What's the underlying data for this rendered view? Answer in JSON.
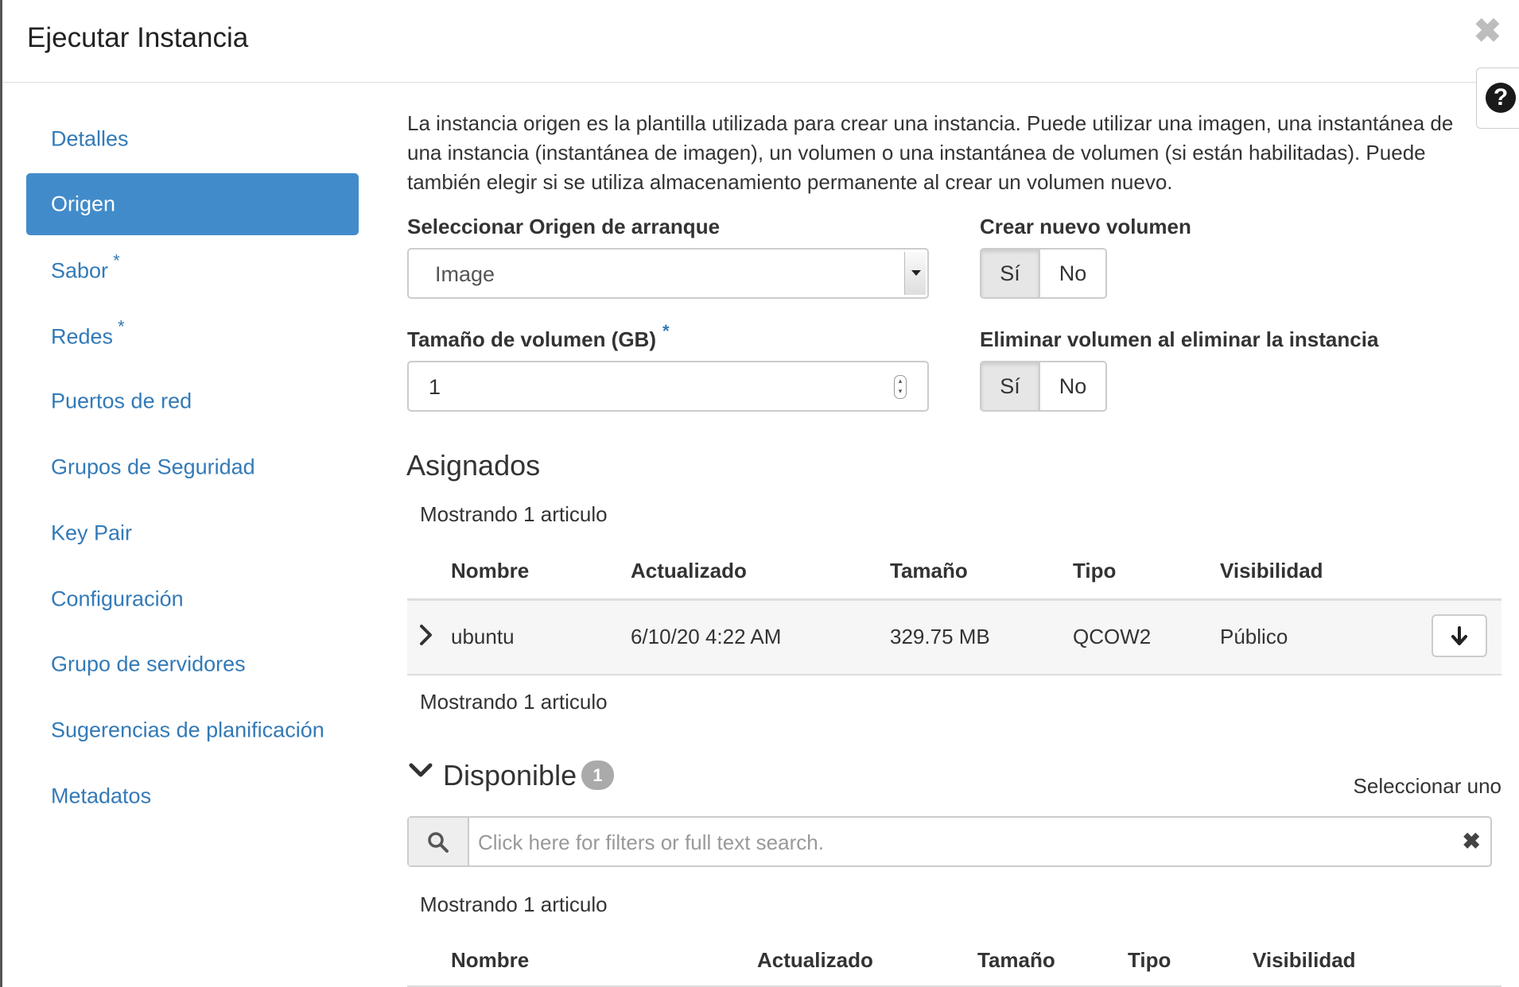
{
  "dialog": {
    "title": "Ejecutar Instancia",
    "close_glyph": "✖",
    "help_glyph": "?"
  },
  "sidebar": {
    "items": [
      {
        "label": "Detalles",
        "required": false,
        "active": false
      },
      {
        "label": "Origen",
        "required": false,
        "active": true
      },
      {
        "label": "Sabor",
        "required": true,
        "active": false
      },
      {
        "label": "Redes",
        "required": true,
        "active": false
      },
      {
        "label": "Puertos de red",
        "required": false,
        "active": false
      },
      {
        "label": "Grupos de Seguridad",
        "required": false,
        "active": false
      },
      {
        "label": "Key Pair",
        "required": false,
        "active": false
      },
      {
        "label": "Configuración",
        "required": false,
        "active": false
      },
      {
        "label": "Grupo de servidores",
        "required": false,
        "active": false
      },
      {
        "label": "Sugerencias de planificación",
        "required": false,
        "active": false
      },
      {
        "label": "Metadatos",
        "required": false,
        "active": false
      }
    ],
    "required_mark": "*"
  },
  "main": {
    "description": "La instancia origen es la plantilla utilizada para crear una instancia. Puede utilizar una imagen, una instantánea de una instancia (instantánea de imagen), un volumen o una instantánea de volumen (si están habilitadas). Puede también elegir si se utiliza almacenamiento permanente al crear un volumen nuevo.",
    "boot_source": {
      "label": "Seleccionar Origen de arranque",
      "value": "Image"
    },
    "new_volume": {
      "label": "Crear nuevo volumen",
      "yes": "Sí",
      "no": "No",
      "selected": "Sí"
    },
    "volume_size": {
      "label": "Tamaño de volumen (GB)",
      "required_mark": "*",
      "value": "1"
    },
    "delete_volume": {
      "label": "Eliminar volumen al eliminar la instancia",
      "yes": "Sí",
      "no": "No",
      "selected": "Sí"
    }
  },
  "allocated": {
    "heading": "Asignados",
    "count_top": "Mostrando 1 articulo",
    "count_bottom": "Mostrando 1 articulo",
    "columns": [
      "Nombre",
      "Actualizado",
      "Tamaño",
      "Tipo",
      "Visibilidad"
    ],
    "rows": [
      {
        "name": "ubuntu",
        "updated": "6/10/20 4:22 AM",
        "size": "329.75 MB",
        "type": "QCOW2",
        "visibility": "Público"
      }
    ]
  },
  "available": {
    "heading": "Disponible",
    "badge": "1",
    "select_hint": "Seleccionar uno",
    "search_placeholder": "Click here for filters or full text search.",
    "count": "Mostrando 1 articulo",
    "columns": [
      "Nombre",
      "Actualizado",
      "Tamaño",
      "Tipo",
      "Visibilidad"
    ]
  },
  "colors": {
    "link": "#337ab7",
    "active_nav": "#428bca",
    "badge": "#aaaaaa"
  },
  "icons": {
    "close": "close-icon",
    "help": "question-circle-icon",
    "expand_row": "chevron-right-icon",
    "allocate_toggle": "arrow-down-icon",
    "collapse_section": "chevron-down-icon",
    "search": "search-icon",
    "clear": "clear-icon"
  }
}
